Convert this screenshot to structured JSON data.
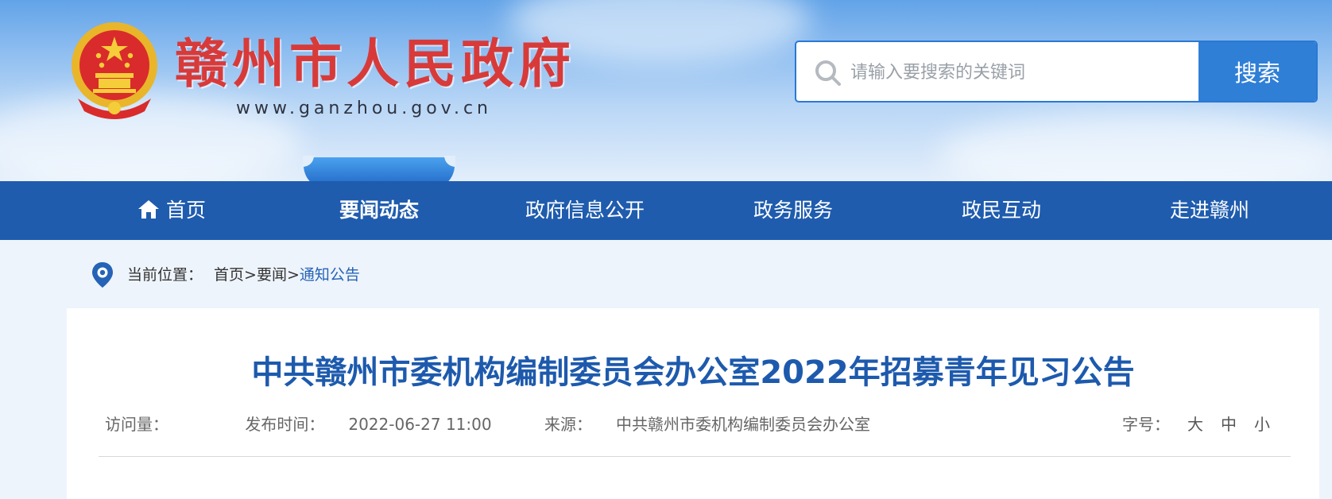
{
  "header": {
    "site_title": "赣州市人民政府",
    "site_url": "www.ganzhou.gov.cn",
    "emblem_icon": "national-emblem-icon"
  },
  "search": {
    "placeholder": "请输入要搜索的关键词",
    "value": "",
    "button_label": "搜索",
    "icon": "search-icon"
  },
  "nav": {
    "items": [
      {
        "label": "首页",
        "icon": "home-icon"
      },
      {
        "label": "要闻动态",
        "active": true
      },
      {
        "label": "政府信息公开"
      },
      {
        "label": "政务服务"
      },
      {
        "label": "政民互动"
      },
      {
        "label": "走进赣州"
      }
    ]
  },
  "breadcrumb": {
    "prefix": "当前位置：",
    "items": [
      "首页",
      "要闻",
      "通知公告"
    ],
    "separator": ">",
    "icon": "location-pin-icon"
  },
  "article": {
    "title": "中共赣州市委机构编制委员会办公室2022年招募青年见习公告",
    "visits_label": "访问量：",
    "visits_value": "",
    "publish_label": "发布时间：",
    "publish_value": "2022-06-27 11:00",
    "source_label": "来源：",
    "source_value": "中共赣州市委机构编制委员会办公室",
    "font_size_label": "字号：",
    "font_size_options": [
      "大",
      "中",
      "小"
    ]
  },
  "colors": {
    "nav_bg": "#1f5cae",
    "title_blue": "#1d5aad",
    "site_title_red": "#d83a3a",
    "search_button": "#2f7fd6"
  }
}
